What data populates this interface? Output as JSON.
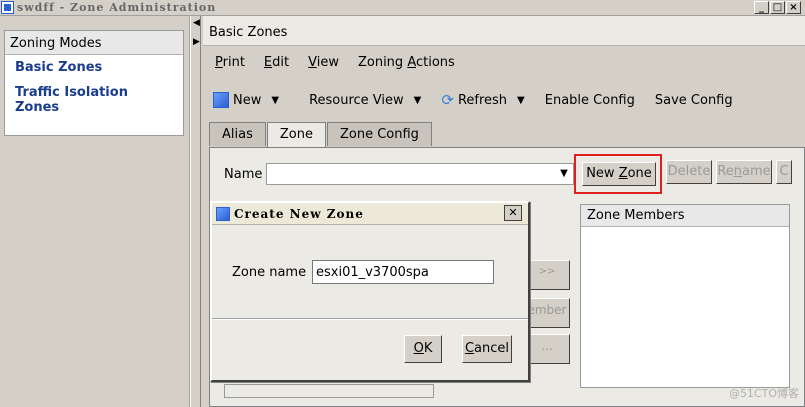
{
  "window": {
    "title": "swdff - Zone Administration"
  },
  "window_buttons": [
    "_",
    "□",
    "×"
  ],
  "left_panel": {
    "header": "Zoning Modes",
    "items": [
      {
        "label": "Basic Zones"
      },
      {
        "label": "Traffic Isolation Zones"
      }
    ]
  },
  "main": {
    "title": "Basic Zones",
    "menu": [
      {
        "label": "Print",
        "u": "P"
      },
      {
        "label": "Edit",
        "u": "E"
      },
      {
        "label": "View",
        "u": "V"
      },
      {
        "label": "Zoning Actions",
        "u": "A"
      }
    ],
    "toolbar": {
      "new": "New",
      "resource_view": "Resource View",
      "refresh": "Refresh",
      "enable_config": "Enable Config",
      "save_config": "Save Config"
    },
    "tabs": [
      {
        "label": "Alias"
      },
      {
        "label": "Zone"
      },
      {
        "label": "Zone Config"
      }
    ],
    "zone_tab": {
      "name_label": "Name",
      "name_value": "",
      "new_zone": "New Zone",
      "delete": "Delete",
      "rename": "Rename",
      "clone": "C",
      "members_header": "Zone Members",
      "add_member_btn": ">>",
      "add_member_text": "ember",
      "more_btn": "..."
    }
  },
  "dialog": {
    "title": "Create New Zone",
    "zone_name_label": "Zone name",
    "zone_name_value": "esxi01_v3700spa",
    "ok": "OK",
    "cancel": "Cancel"
  },
  "watermark": "@51CTO博客",
  "colors": {
    "link": "#1a3d8f",
    "highlight_border": "#e02020"
  }
}
